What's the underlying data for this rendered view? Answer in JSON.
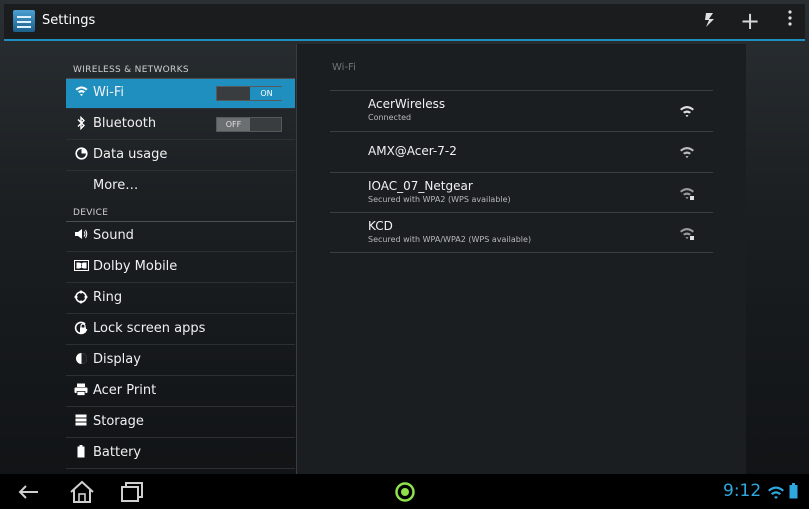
{
  "actionbar": {
    "title": "Settings",
    "icons": [
      "settings-app-icon",
      "sync-icon",
      "add-icon",
      "overflow-menu-icon"
    ]
  },
  "sidebar": {
    "sections": [
      {
        "header": "WIRELESS & NETWORKS"
      },
      {
        "header": "DEVICE"
      }
    ],
    "items": [
      {
        "label": "Wi-Fi",
        "icon": "wifi-icon",
        "toggle": "ON",
        "selected": true
      },
      {
        "label": "Bluetooth",
        "icon": "bluetooth-icon",
        "toggle": "OFF"
      },
      {
        "label": "Data usage",
        "icon": "data-usage-icon"
      },
      {
        "label": "More…",
        "icon": ""
      },
      {
        "label": "Sound",
        "icon": "sound-icon"
      },
      {
        "label": "Dolby Mobile",
        "icon": "dolby-icon"
      },
      {
        "label": "Ring",
        "icon": "ring-icon"
      },
      {
        "label": "Lock screen apps",
        "icon": "lock-screen-icon"
      },
      {
        "label": "Display",
        "icon": "display-icon"
      },
      {
        "label": "Acer Print",
        "icon": "printer-icon"
      },
      {
        "label": "Storage",
        "icon": "storage-icon"
      },
      {
        "label": "Battery",
        "icon": "battery-icon"
      }
    ]
  },
  "wifi": {
    "header": "Wi-Fi",
    "networks": [
      {
        "name": "AcerWireless",
        "status": "Connected",
        "secured": false
      },
      {
        "name": "AMX@Acer-7-2",
        "status": "",
        "secured": false
      },
      {
        "name": "IOAC_07_Netgear",
        "status": "Secured with WPA2 (WPS available)",
        "secured": true
      },
      {
        "name": "KCD",
        "status": "Secured with WPA/WPA2 (WPS available)",
        "secured": true
      }
    ]
  },
  "navbar": {
    "clock": "9:12",
    "accent_color": "#1f8fc0"
  }
}
